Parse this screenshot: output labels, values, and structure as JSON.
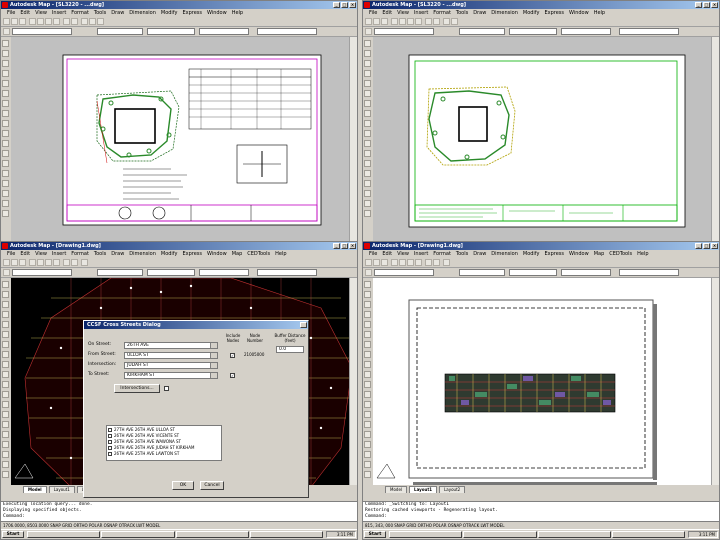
{
  "windows": {
    "top_left": {
      "title": "Autodesk Map - [SL3220 - ...dwg]",
      "menu": [
        "File",
        "Edit",
        "View",
        "Insert",
        "Format",
        "Tools",
        "Draw",
        "Dimension",
        "Modify",
        "Express",
        "Window",
        "Help",
        "NEW",
        "CEDTools",
        "Map"
      ],
      "tabs": [
        "Model",
        "Layout1",
        "CSD Layout - Landscape"
      ],
      "status": "2.0000, 1.0000, 0.0000  SNAP GRID ORTHO POLAR OSNAP OTRACK LWT MODEL"
    },
    "top_right": {
      "title": "Autodesk Map - [SL3220 - ...dwg]",
      "menu": [
        "File",
        "Edit",
        "View",
        "Insert",
        "Format",
        "Tools",
        "Draw",
        "Dimension",
        "Modify",
        "Express",
        "Window",
        "Help",
        "CEDTools",
        "Map"
      ],
      "tabs": [
        "Model",
        "Layout1",
        "Layout - Results Layout"
      ],
      "status": "SNAP GRID ORTHO POLAR OSNAP OTRACK LWT PAPER"
    },
    "bottom_left": {
      "title": "Autodesk Map - [Drawing1.dwg]",
      "menu": [
        "File",
        "Edit",
        "View",
        "Insert",
        "Format",
        "Tools",
        "Draw",
        "Dimension",
        "Modify",
        "Express",
        "Window",
        "Map",
        "CEDTools",
        "Help"
      ],
      "tabs": [
        "Model",
        "Layout1",
        "Layout2"
      ],
      "command_lines": [
        "Executing location query... done.",
        "Displaying specified objects.",
        "Command:"
      ],
      "status": "1706.0000, 8503.0000  SNAP GRID ORTHO POLAR OSNAP OTRACK LWT MODEL",
      "taskbar_start": "Start",
      "taskbar_clock": "3:11 PM"
    },
    "bottom_right": {
      "title": "Autodesk Map - [Drawing1.dwg]",
      "menu": [
        "File",
        "Edit",
        "View",
        "Insert",
        "Format",
        "Tools",
        "Draw",
        "Dimension",
        "Modify",
        "Express",
        "Window",
        "Map",
        "CEDTools",
        "Help"
      ],
      "tabs": [
        "Model",
        "Layout1",
        "Layout2"
      ],
      "command_lines": [
        "Command: _Switching to: Layout1",
        "Restoring cached viewports - Regenerating layout.",
        "Command:"
      ],
      "status": "815,  343,  000       SNAP GRID ORTHO POLAR OSNAP OTRACK LWT MODEL",
      "taskbar_start": "Start",
      "taskbar_clock": "3:11 PM"
    }
  },
  "dialog": {
    "title": "CCSF Cross Streets Dialog",
    "labels": {
      "on_street": "On Street:",
      "from_street": "From Street:",
      "intersection": "Intersection:",
      "to_street": "To Street:",
      "include_nodes": "Include Nodes",
      "node_number": "Node Number",
      "buffer": "Buffer Distance (feet)"
    },
    "values": {
      "on_street": "26TH AVE",
      "from_street": "ULLOA ST",
      "intersection": "JUDAH ST",
      "to_street": "KIRKHAM ST",
      "buffer": "0.0",
      "node_number": "21005000"
    },
    "options_button": "Intersections...",
    "list_items": [
      "27TH AVE 26TH AVE ULLOA ST",
      "26TH AVE 26TH AVE VICENTE ST",
      "26TH AVE 26TH AVE WAWONA ST",
      "26TH AVE 26TH AVE JUDAH ST KIRKHAM",
      "26TH AVE 25TH AVE LAWTON ST",
      "26TH AVE 26TH AVE MORAGA ST"
    ],
    "ok_label": "OK",
    "cancel_label": "Cancel"
  }
}
